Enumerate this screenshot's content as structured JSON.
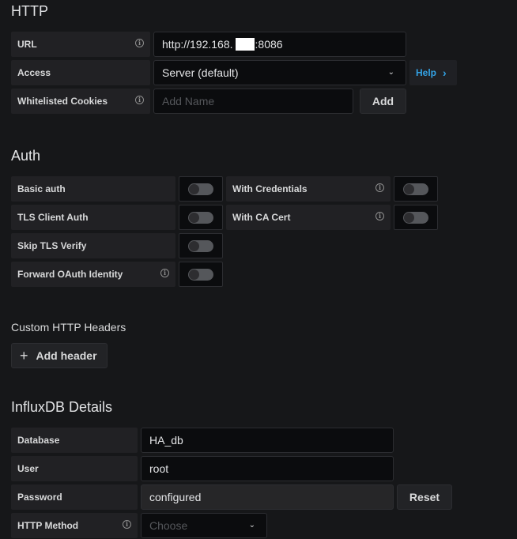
{
  "http": {
    "title": "HTTP",
    "url": {
      "label": "URL",
      "value": "http://192.168.  :8086"
    },
    "access": {
      "label": "Access",
      "value": "Server (default)",
      "help_label": "Help",
      "help_icon": "chevron-right-icon"
    },
    "cookies": {
      "label": "Whitelisted Cookies",
      "placeholder": "Add Name",
      "add_label": "Add"
    }
  },
  "auth": {
    "title": "Auth",
    "toggles": [
      {
        "label": "Basic auth",
        "on": false,
        "info": false
      },
      {
        "label": "TLS Client Auth",
        "on": false,
        "info": false
      },
      {
        "label": "Skip TLS Verify",
        "on": false,
        "info": false
      },
      {
        "label": "Forward OAuth Identity",
        "on": false,
        "info": true
      },
      {
        "label": "With Credentials",
        "on": false,
        "info": true
      },
      {
        "label": "With CA Cert",
        "on": false,
        "info": true
      }
    ]
  },
  "headers": {
    "title": "Custom HTTP Headers",
    "add_label": "Add header",
    "add_icon": "plus-icon"
  },
  "influx": {
    "title": "InfluxDB Details",
    "database": {
      "label": "Database",
      "value": "HA_db"
    },
    "user": {
      "label": "User",
      "value": "root"
    },
    "password": {
      "label": "Password",
      "value": "configured",
      "reset_label": "Reset"
    },
    "method": {
      "label": "HTTP Method",
      "placeholder": "Choose"
    }
  },
  "icons": {
    "info": "i",
    "chevron_down": "⌄",
    "chevron_right": "›",
    "plus": "+"
  },
  "colors": {
    "background": "#161719",
    "accent": "#33a2e5",
    "label_bg": "#212124",
    "input_bg": "#0b0c0e"
  }
}
